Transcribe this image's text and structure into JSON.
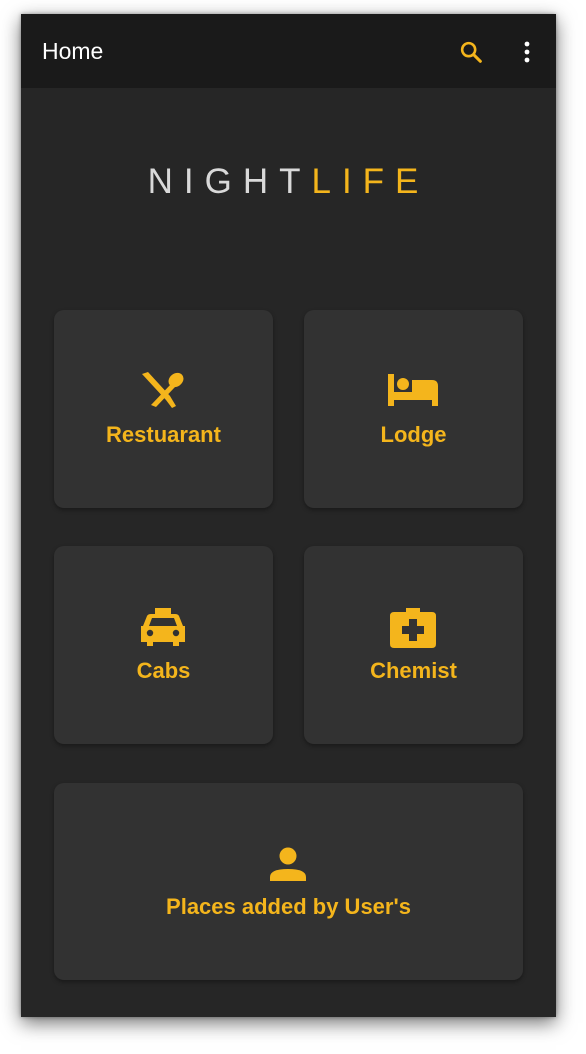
{
  "appbar": {
    "title": "Home",
    "icons": [
      "search-icon",
      "more-vert-icon"
    ]
  },
  "logo": {
    "part1": "NIGHT",
    "part2": "LIFE"
  },
  "categories": [
    {
      "label": "Restuarant",
      "icon": "restaurant-icon"
    },
    {
      "label": "Lodge",
      "icon": "bed-icon"
    },
    {
      "label": "Cabs",
      "icon": "taxi-icon"
    },
    {
      "label": "Chemist",
      "icon": "medical-icon"
    }
  ],
  "user_places": {
    "label": "Places added by User's",
    "icon": "person-icon"
  },
  "colors": {
    "accent": "#f4b51c",
    "background": "#262626",
    "appbar": "#1a1a1a",
    "card": "#323232"
  }
}
